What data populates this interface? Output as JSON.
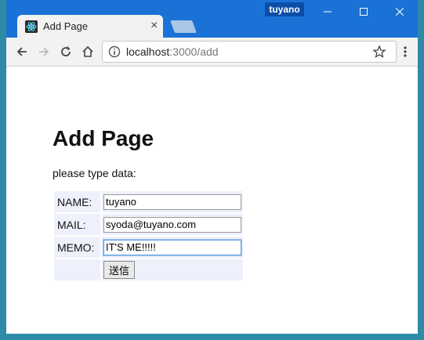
{
  "window": {
    "profile_name": "tuyano"
  },
  "tab": {
    "title": "Add Page",
    "close_glyph": "×",
    "favicon": "react-icon"
  },
  "toolbar": {
    "url_host": "localhost",
    "url_rest": ":3000/add"
  },
  "page": {
    "title": "Add Page",
    "prompt": "please type data:",
    "form": {
      "name_label": "NAME:",
      "name_value": "tuyano",
      "mail_label": "MAIL:",
      "mail_value": "syoda@tuyano.com",
      "memo_label": "MEMO:",
      "memo_value": "IT'S ME!!!!!",
      "submit_label": "送信"
    }
  },
  "colors": {
    "titlebar": "#1b72d6",
    "form_cell_bg": "#eef0fb"
  }
}
